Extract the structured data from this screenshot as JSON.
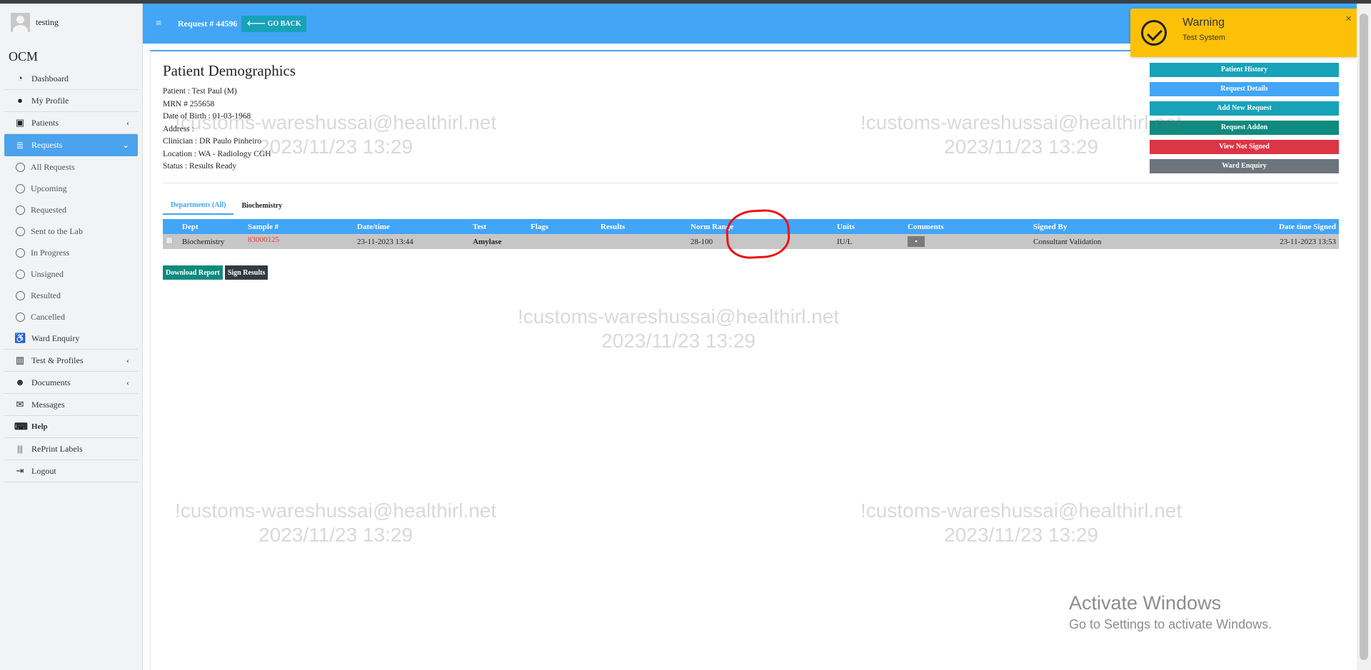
{
  "user": {
    "name": "testing"
  },
  "brand": "OCM",
  "nav": {
    "dashboard": "Dashboard",
    "profile": "My Profile",
    "patients": "Patients",
    "requests": "Requests",
    "sub": [
      "All Requests",
      "Upcoming",
      "Requested",
      "Sent to the Lab",
      "In Progress",
      "Unsigned",
      "Resulted",
      "Cancelled"
    ],
    "ward": "Ward Enquiry",
    "tests": "Test & Profiles",
    "documents": "Documents",
    "messages": "Messages",
    "help": "Help",
    "reprint": "RePrint Labels",
    "logout": "Logout"
  },
  "header": {
    "title": "Request # 44596",
    "go_back": "GO BACK"
  },
  "demographics": {
    "title": "Patient Demographics",
    "patient": "Patient : Test Paul (M)",
    "mrn": "MRN # 255658",
    "dob": "Date of Birth : 01-03-1968",
    "address": "Address :",
    "clinician": "Clinician : DR Paulo Pinheiro",
    "location": "Location : WA - Radiology CGH",
    "status": "Status : Results Ready"
  },
  "side_buttons": [
    {
      "label": "Patient History",
      "color": "#17a2b8"
    },
    {
      "label": "Request Details",
      "color": "#42a5f5"
    },
    {
      "label": "Add New Request",
      "color": "#17a2b8"
    },
    {
      "label": "Request Addon",
      "color": "#0f8a7e"
    },
    {
      "label": "View Not Signed",
      "color": "#dc3545"
    },
    {
      "label": "Ward Enquiry",
      "color": "#6c757d"
    }
  ],
  "tabs": [
    "Departments (All)",
    "Biochemistry"
  ],
  "table": {
    "headers": [
      "Dept",
      "Sample #",
      "Date/time",
      "Test",
      "Flags",
      "Results",
      "Norm Range",
      "Units",
      "Comments",
      "Signed By",
      "Date time Signed"
    ],
    "rows": [
      {
        "dept": "Biochemistry",
        "sample": "83000125",
        "datetime": "23-11-2023 13:44",
        "test": "Amylase",
        "flags": "",
        "results": "",
        "range": "28-100",
        "units": "IU/L",
        "signed_by": "Consultant Validation",
        "signed_at": "23-11-2023 13:53"
      }
    ]
  },
  "actions": {
    "download": "Download Report",
    "sign": "Sign Results"
  },
  "watermark": {
    "line1": "!customs-wareshussai@healthirl.net",
    "line2": "2023/11/23 13:29"
  },
  "toast": {
    "title": "Warning",
    "message": "Test System",
    "close": "×"
  },
  "activate": {
    "line1": "Activate Windows",
    "line2": "Go to Settings to activate Windows."
  },
  "colors": {
    "primary": "#42a5f5",
    "teal": "#17a2b8",
    "danger": "#dc3545",
    "warning": "#fcc107"
  }
}
